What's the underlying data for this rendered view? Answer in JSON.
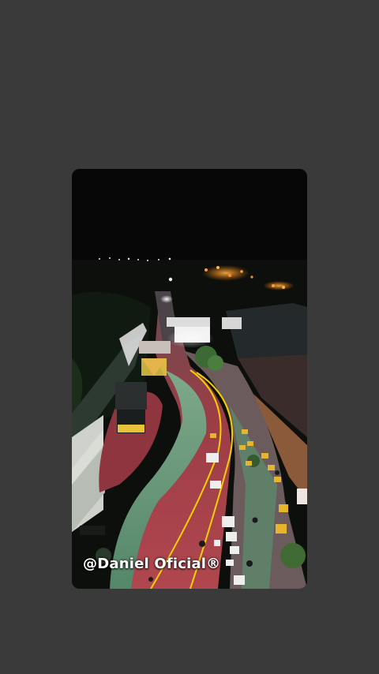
{
  "media": {
    "type": "video-frame",
    "description_icon": "aerial-night-street-photo",
    "watermark": "@Daniel Oficial®"
  },
  "colors": {
    "background": "#3a3a3a",
    "road": "#a8434a",
    "median": "#5f8f6a",
    "sky": "#070707",
    "city_lights": "#f0a030",
    "lane_lines": "#f5d000"
  }
}
